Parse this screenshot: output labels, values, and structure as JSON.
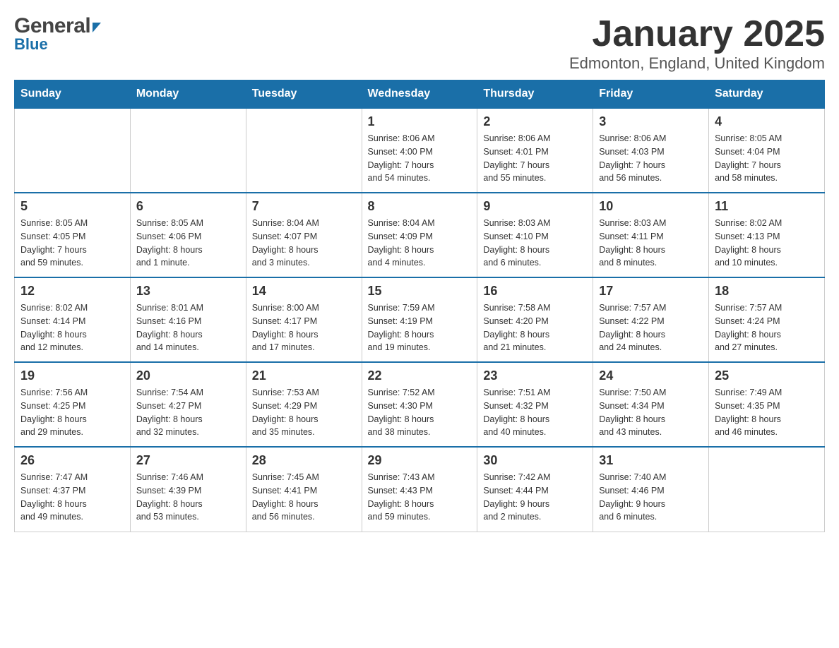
{
  "header": {
    "logo_general": "General",
    "logo_blue": "Blue",
    "title": "January 2025",
    "subtitle": "Edmonton, England, United Kingdom"
  },
  "days_of_week": [
    "Sunday",
    "Monday",
    "Tuesday",
    "Wednesday",
    "Thursday",
    "Friday",
    "Saturday"
  ],
  "weeks": [
    [
      {
        "day": "",
        "info": ""
      },
      {
        "day": "",
        "info": ""
      },
      {
        "day": "",
        "info": ""
      },
      {
        "day": "1",
        "info": "Sunrise: 8:06 AM\nSunset: 4:00 PM\nDaylight: 7 hours\nand 54 minutes."
      },
      {
        "day": "2",
        "info": "Sunrise: 8:06 AM\nSunset: 4:01 PM\nDaylight: 7 hours\nand 55 minutes."
      },
      {
        "day": "3",
        "info": "Sunrise: 8:06 AM\nSunset: 4:03 PM\nDaylight: 7 hours\nand 56 minutes."
      },
      {
        "day": "4",
        "info": "Sunrise: 8:05 AM\nSunset: 4:04 PM\nDaylight: 7 hours\nand 58 minutes."
      }
    ],
    [
      {
        "day": "5",
        "info": "Sunrise: 8:05 AM\nSunset: 4:05 PM\nDaylight: 7 hours\nand 59 minutes."
      },
      {
        "day": "6",
        "info": "Sunrise: 8:05 AM\nSunset: 4:06 PM\nDaylight: 8 hours\nand 1 minute."
      },
      {
        "day": "7",
        "info": "Sunrise: 8:04 AM\nSunset: 4:07 PM\nDaylight: 8 hours\nand 3 minutes."
      },
      {
        "day": "8",
        "info": "Sunrise: 8:04 AM\nSunset: 4:09 PM\nDaylight: 8 hours\nand 4 minutes."
      },
      {
        "day": "9",
        "info": "Sunrise: 8:03 AM\nSunset: 4:10 PM\nDaylight: 8 hours\nand 6 minutes."
      },
      {
        "day": "10",
        "info": "Sunrise: 8:03 AM\nSunset: 4:11 PM\nDaylight: 8 hours\nand 8 minutes."
      },
      {
        "day": "11",
        "info": "Sunrise: 8:02 AM\nSunset: 4:13 PM\nDaylight: 8 hours\nand 10 minutes."
      }
    ],
    [
      {
        "day": "12",
        "info": "Sunrise: 8:02 AM\nSunset: 4:14 PM\nDaylight: 8 hours\nand 12 minutes."
      },
      {
        "day": "13",
        "info": "Sunrise: 8:01 AM\nSunset: 4:16 PM\nDaylight: 8 hours\nand 14 minutes."
      },
      {
        "day": "14",
        "info": "Sunrise: 8:00 AM\nSunset: 4:17 PM\nDaylight: 8 hours\nand 17 minutes."
      },
      {
        "day": "15",
        "info": "Sunrise: 7:59 AM\nSunset: 4:19 PM\nDaylight: 8 hours\nand 19 minutes."
      },
      {
        "day": "16",
        "info": "Sunrise: 7:58 AM\nSunset: 4:20 PM\nDaylight: 8 hours\nand 21 minutes."
      },
      {
        "day": "17",
        "info": "Sunrise: 7:57 AM\nSunset: 4:22 PM\nDaylight: 8 hours\nand 24 minutes."
      },
      {
        "day": "18",
        "info": "Sunrise: 7:57 AM\nSunset: 4:24 PM\nDaylight: 8 hours\nand 27 minutes."
      }
    ],
    [
      {
        "day": "19",
        "info": "Sunrise: 7:56 AM\nSunset: 4:25 PM\nDaylight: 8 hours\nand 29 minutes."
      },
      {
        "day": "20",
        "info": "Sunrise: 7:54 AM\nSunset: 4:27 PM\nDaylight: 8 hours\nand 32 minutes."
      },
      {
        "day": "21",
        "info": "Sunrise: 7:53 AM\nSunset: 4:29 PM\nDaylight: 8 hours\nand 35 minutes."
      },
      {
        "day": "22",
        "info": "Sunrise: 7:52 AM\nSunset: 4:30 PM\nDaylight: 8 hours\nand 38 minutes."
      },
      {
        "day": "23",
        "info": "Sunrise: 7:51 AM\nSunset: 4:32 PM\nDaylight: 8 hours\nand 40 minutes."
      },
      {
        "day": "24",
        "info": "Sunrise: 7:50 AM\nSunset: 4:34 PM\nDaylight: 8 hours\nand 43 minutes."
      },
      {
        "day": "25",
        "info": "Sunrise: 7:49 AM\nSunset: 4:35 PM\nDaylight: 8 hours\nand 46 minutes."
      }
    ],
    [
      {
        "day": "26",
        "info": "Sunrise: 7:47 AM\nSunset: 4:37 PM\nDaylight: 8 hours\nand 49 minutes."
      },
      {
        "day": "27",
        "info": "Sunrise: 7:46 AM\nSunset: 4:39 PM\nDaylight: 8 hours\nand 53 minutes."
      },
      {
        "day": "28",
        "info": "Sunrise: 7:45 AM\nSunset: 4:41 PM\nDaylight: 8 hours\nand 56 minutes."
      },
      {
        "day": "29",
        "info": "Sunrise: 7:43 AM\nSunset: 4:43 PM\nDaylight: 8 hours\nand 59 minutes."
      },
      {
        "day": "30",
        "info": "Sunrise: 7:42 AM\nSunset: 4:44 PM\nDaylight: 9 hours\nand 2 minutes."
      },
      {
        "day": "31",
        "info": "Sunrise: 7:40 AM\nSunset: 4:46 PM\nDaylight: 9 hours\nand 6 minutes."
      },
      {
        "day": "",
        "info": ""
      }
    ]
  ]
}
